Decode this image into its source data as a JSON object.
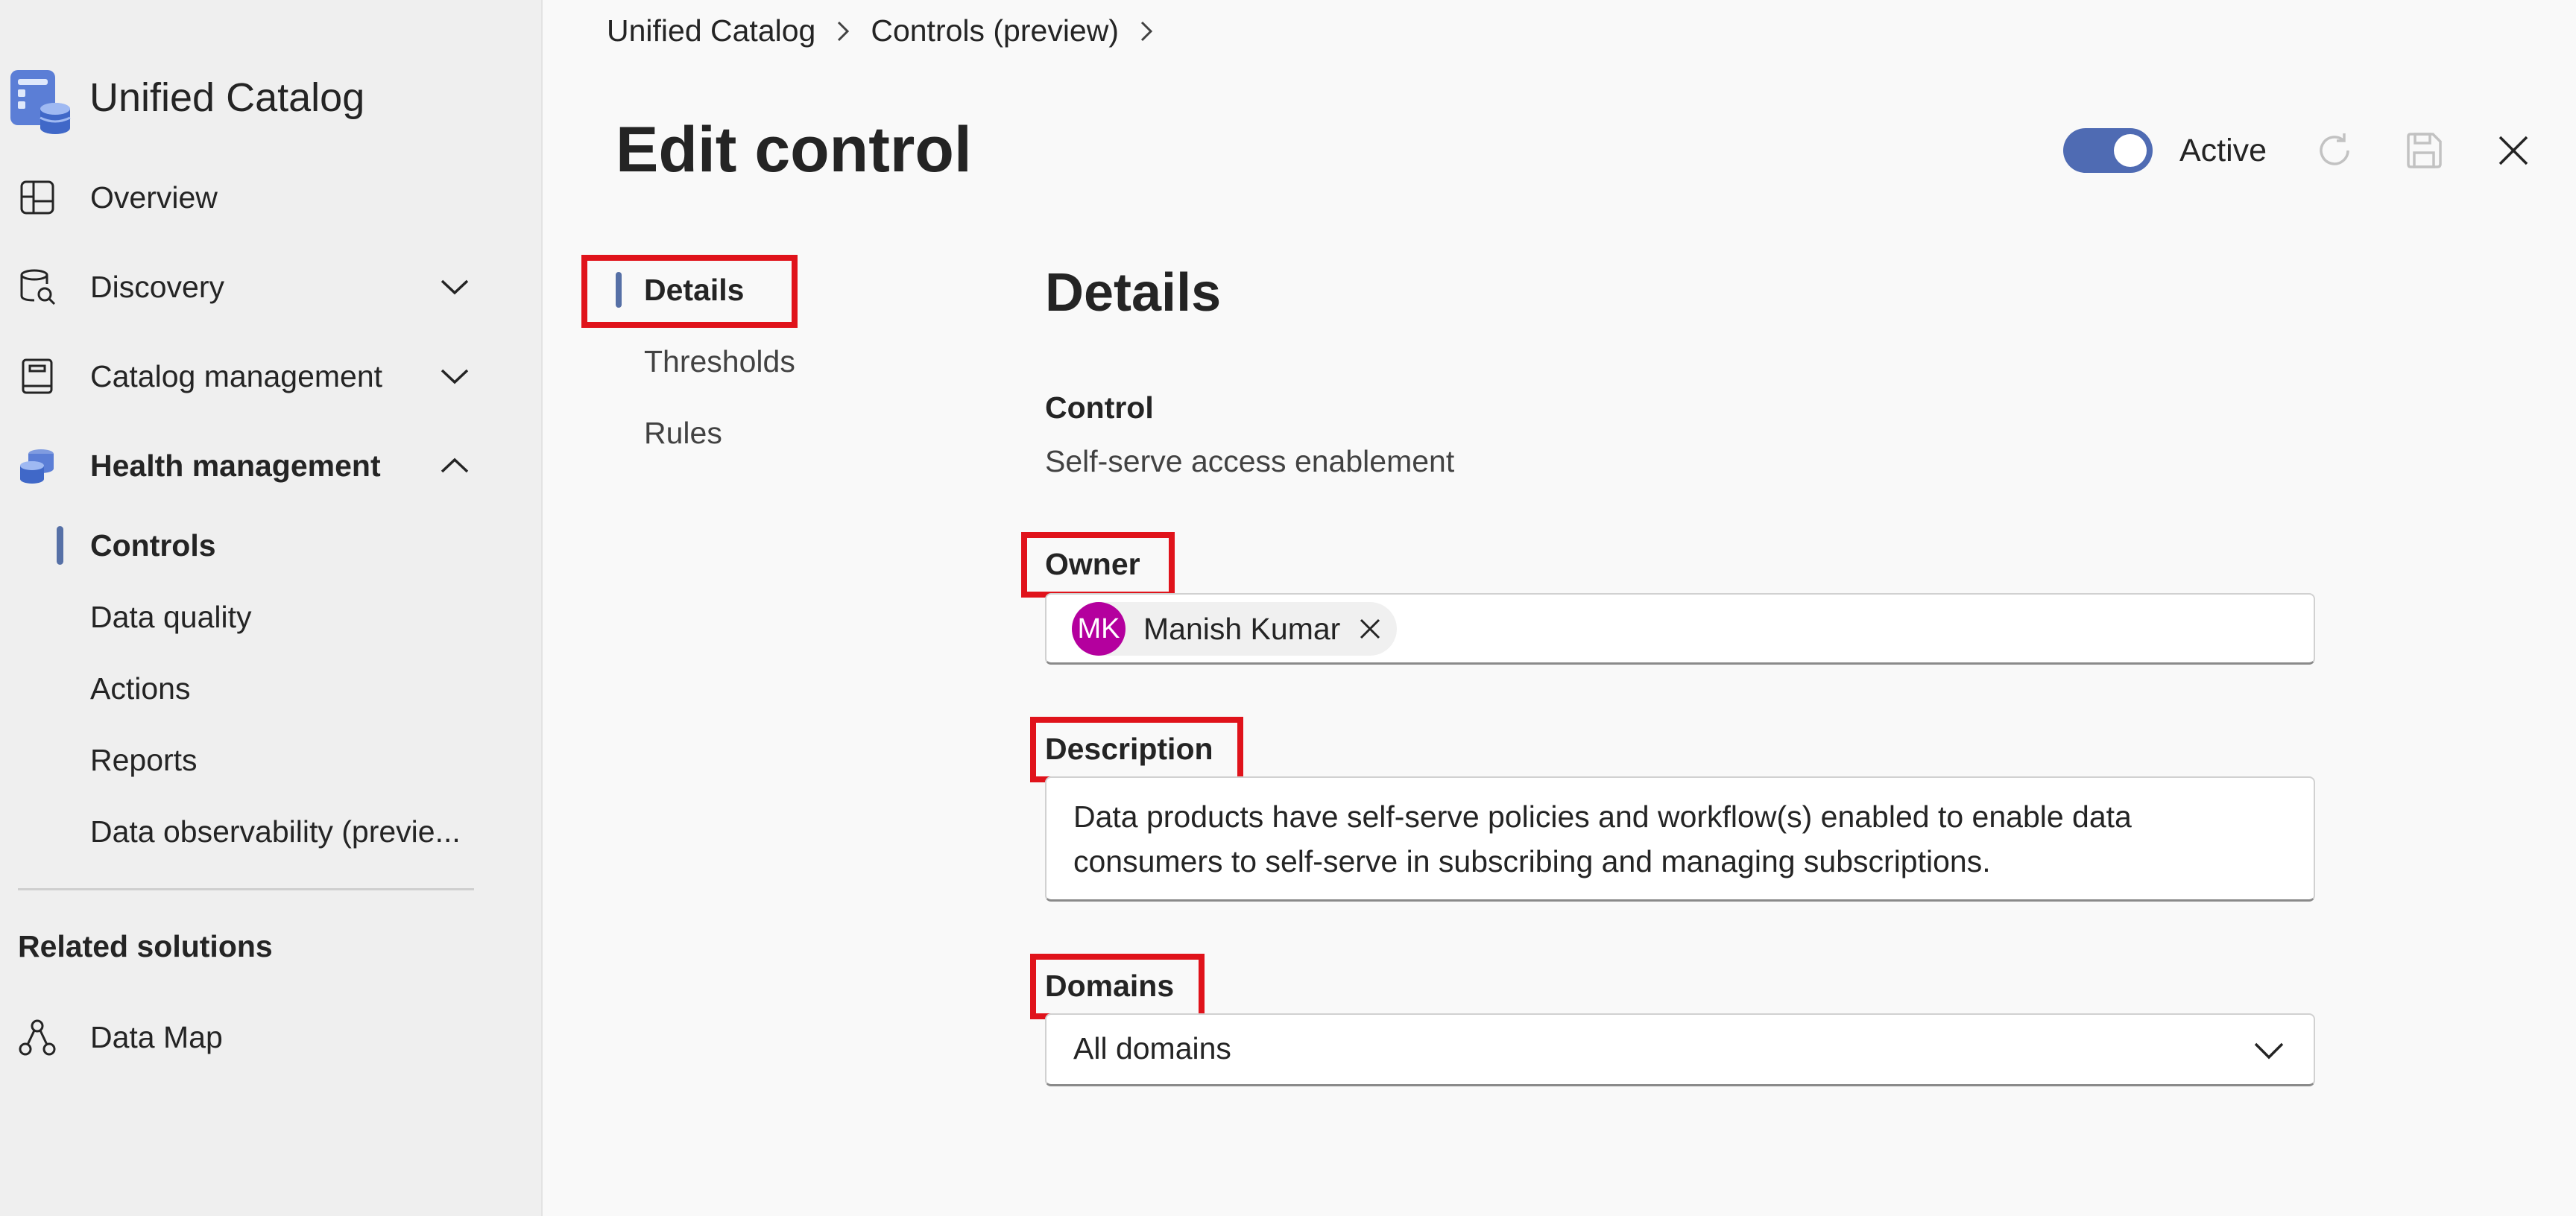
{
  "sidebar": {
    "app_title": "Unified Catalog",
    "logo_icon": "catalog-database-icon",
    "nav": [
      {
        "label": "Overview",
        "icon": "dashboard-grid-icon"
      },
      {
        "label": "Discovery",
        "icon": "database-search-icon",
        "expanded": false
      },
      {
        "label": "Catalog management",
        "icon": "book-icon",
        "expanded": false
      },
      {
        "label": "Health management",
        "icon": "database-stack-icon",
        "expanded": true
      }
    ],
    "health_items": [
      "Controls",
      "Data quality",
      "Actions",
      "Reports",
      "Data observability (previe..."
    ],
    "active_item": "Controls",
    "related_label": "Related solutions",
    "related": [
      {
        "label": "Data Map",
        "icon": "data-map-nodes-icon"
      }
    ]
  },
  "breadcrumb": [
    "Unified Catalog",
    "Controls (preview)"
  ],
  "page_title": "Edit control",
  "header_actions": {
    "status_label": "Active",
    "status_on": true,
    "icons": [
      "refresh-icon",
      "save-icon",
      "close-icon"
    ]
  },
  "subnav": [
    "Details",
    "Thresholds",
    "Rules"
  ],
  "subnav_active": "Details",
  "form": {
    "section_title": "Details",
    "control_label": "Control",
    "control_value": "Self-serve access enablement",
    "owner_label": "Owner",
    "owner": {
      "initials": "MK",
      "name": "Manish Kumar"
    },
    "description_label": "Description",
    "description_value": "Data products have self-serve policies and workflow(s) enabled to enable data consumers to self-serve in subscribing and managing subscriptions.",
    "domains_label": "Domains",
    "domains_value": "All domains"
  },
  "colors": {
    "accent": "#5670a6",
    "toggle": "#4f6bb3",
    "highlight_box": "#e0131b",
    "avatar": "#b4009e"
  }
}
